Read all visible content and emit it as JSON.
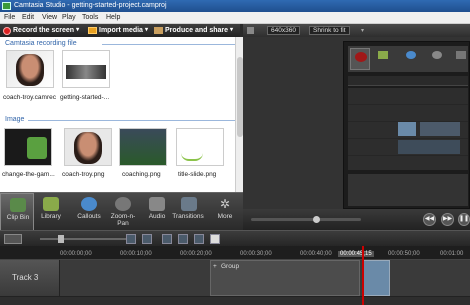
{
  "window": {
    "title": "Camtasia Studio - getting-started-project.camproj"
  },
  "menu": [
    "File",
    "Edit",
    "View",
    "Play",
    "Tools",
    "Help"
  ],
  "toolbar": {
    "record": "Record the screen",
    "import": "Import media",
    "produce": "Produce and share"
  },
  "clipbin": {
    "section1": "Camtasia recording file",
    "section2": "Image",
    "items1": [
      "coach-troy.camrec",
      "getting-started-..."
    ],
    "items2": [
      "change-the-gam...",
      "coach-troy.png",
      "coaching.png",
      "title-slide.png"
    ]
  },
  "tabs": [
    "Clip Bin",
    "Library",
    "Callouts",
    "Zoom-n-Pan",
    "Audio",
    "Transitions",
    "More"
  ],
  "preview": {
    "size": "640x360",
    "fit": "Shrink to fit"
  },
  "timeline": {
    "ticks": [
      "00:00:00;00",
      "00:00:10;00",
      "00:00:20;00",
      "00:00:30;00",
      "00:00:40;00",
      "00:00:45;15",
      "00:00:50;00",
      "00:01:00"
    ],
    "track": "Track 3",
    "group": "Group"
  },
  "colors": {
    "accent": "#2f6ab2",
    "record": "#d22222",
    "playhead": "#cc0000"
  }
}
